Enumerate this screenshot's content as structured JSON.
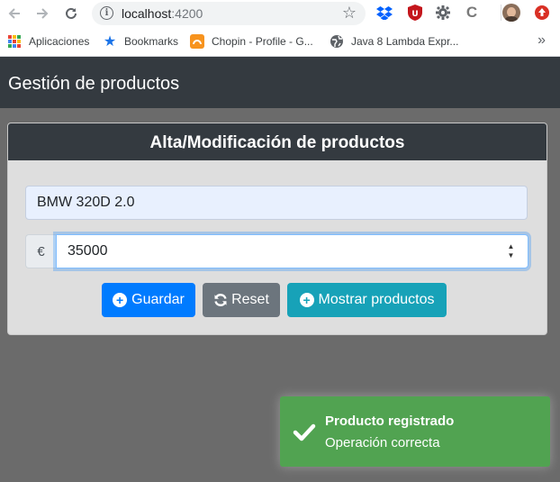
{
  "browser": {
    "url_host": "localhost",
    "url_port": ":4200",
    "bookmarks": [
      {
        "label": "Aplicaciones",
        "icon": "apps-grid-icon"
      },
      {
        "label": "Bookmarks",
        "icon": "star-icon"
      },
      {
        "label": "Chopin - Profile - G...",
        "icon": "chopin-icon"
      },
      {
        "label": "Java 8 Lambda Expr...",
        "icon": "globe-icon"
      }
    ],
    "more": "»"
  },
  "navbar": {
    "brand": "Gestión de productos"
  },
  "form": {
    "title": "Alta/Modificación de productos",
    "name_value": "BMW 320D 2.0",
    "currency_symbol": "€",
    "price_value": "35000",
    "buttons": {
      "save": "Guardar",
      "reset": "Reset",
      "show": "Mostrar productos"
    }
  },
  "toast": {
    "title": "Producto registrado",
    "message": "Operación correcta"
  },
  "colors": {
    "navbar": "#343a40",
    "primary": "#007bff",
    "secondary": "#6c757d",
    "info": "#17a2b8",
    "success": "#51a351"
  }
}
